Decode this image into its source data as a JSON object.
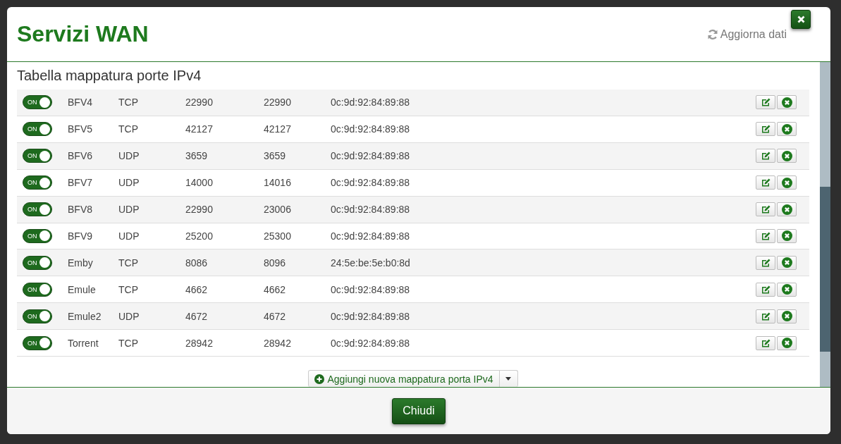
{
  "dialog": {
    "title": "Servizi WAN",
    "refresh": "Aggiorna dati",
    "close_button": "Chiudi"
  },
  "table": {
    "title": "Tabella mappatura porte IPv4",
    "add_button": "Aggiungi nuova mappatura porta IPv4",
    "rows": [
      {
        "enabled": true,
        "toggle_label": "ON",
        "name": "BFV4",
        "protocol": "TCP",
        "column_3": "22990",
        "column_4": "22990",
        "column_5": "0c:9d:92:84:89:88"
      },
      {
        "enabled": true,
        "toggle_label": "ON",
        "name": "BFV5",
        "protocol": "TCP",
        "column_3": "42127",
        "column_4": "42127",
        "column_5": "0c:9d:92:84:89:88"
      },
      {
        "enabled": true,
        "toggle_label": "ON",
        "name": "BFV6",
        "protocol": "UDP",
        "column_3": "3659",
        "column_4": "3659",
        "column_5": "0c:9d:92:84:89:88"
      },
      {
        "enabled": true,
        "toggle_label": "ON",
        "name": "BFV7",
        "protocol": "UDP",
        "column_3": "14000",
        "column_4": "14016",
        "column_5": "0c:9d:92:84:89:88"
      },
      {
        "enabled": true,
        "toggle_label": "ON",
        "name": "BFV8",
        "protocol": "UDP",
        "column_3": "22990",
        "column_4": "23006",
        "column_5": "0c:9d:92:84:89:88"
      },
      {
        "enabled": true,
        "toggle_label": "ON",
        "name": "BFV9",
        "protocol": "UDP",
        "column_3": "25200",
        "column_4": "25300",
        "column_5": "0c:9d:92:84:89:88"
      },
      {
        "enabled": true,
        "toggle_label": "ON",
        "name": "Emby",
        "protocol": "TCP",
        "column_3": "8086",
        "column_4": "8096",
        "column_5": "24:5e:be:5e:b0:8d"
      },
      {
        "enabled": true,
        "toggle_label": "ON",
        "name": "Emule",
        "protocol": "TCP",
        "column_3": "4662",
        "column_4": "4662",
        "column_5": "0c:9d:92:84:89:88"
      },
      {
        "enabled": true,
        "toggle_label": "ON",
        "name": "Emule2",
        "protocol": "UDP",
        "column_3": "4672",
        "column_4": "4672",
        "column_5": "0c:9d:92:84:89:88"
      },
      {
        "enabled": true,
        "toggle_label": "ON",
        "name": "Torrent",
        "protocol": "TCP",
        "column_3": "28942",
        "column_4": "28942",
        "column_5": "0c:9d:92:84:89:88"
      }
    ]
  }
}
